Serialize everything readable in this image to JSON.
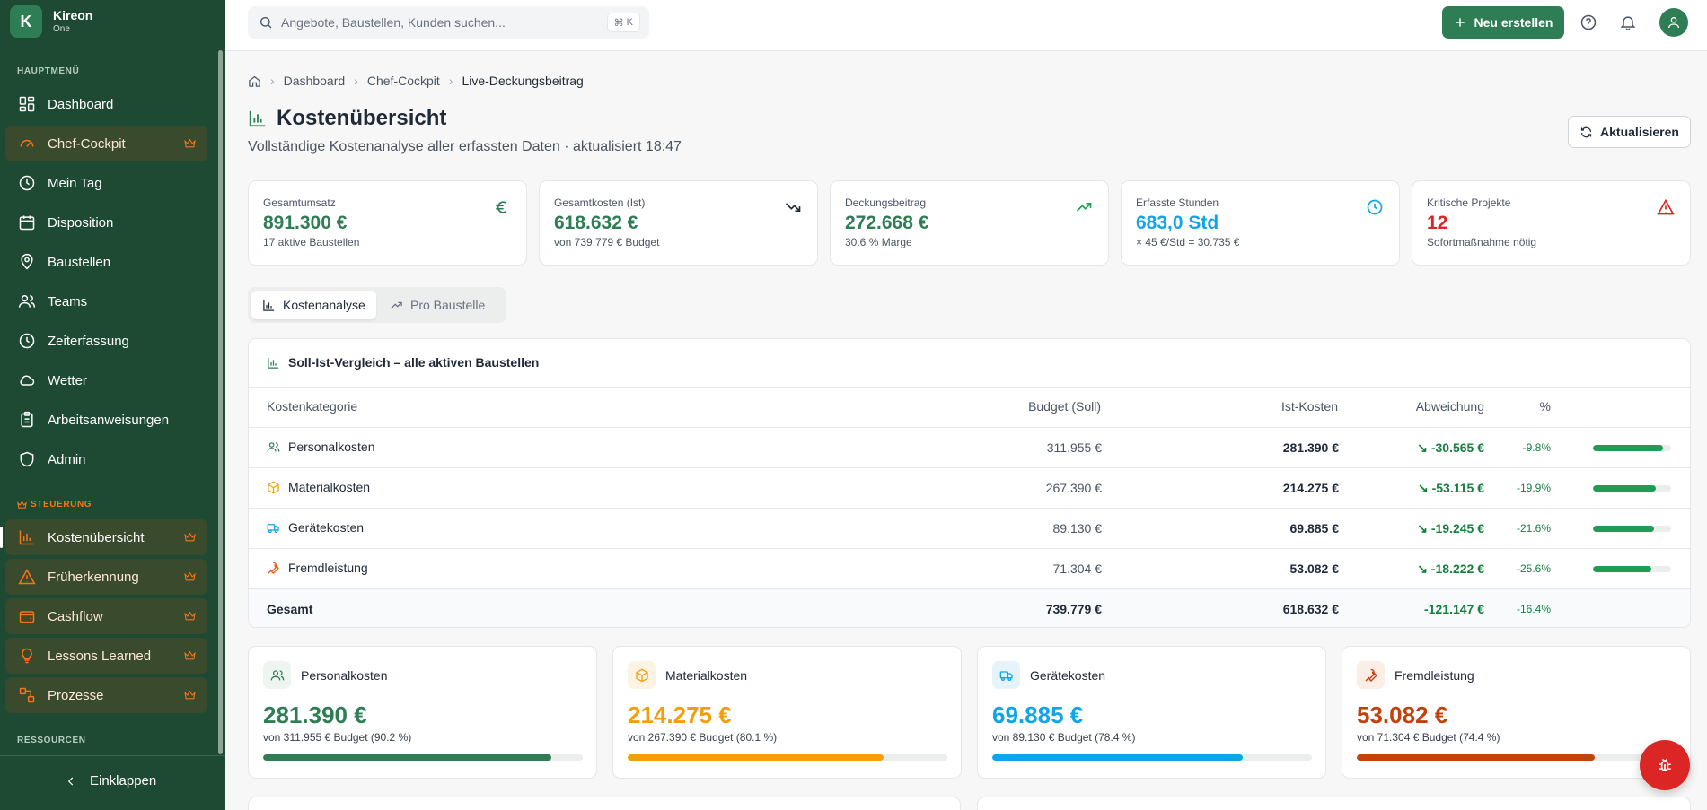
{
  "brand": {
    "name": "Kireon",
    "sub": "One",
    "logo_letter": "K"
  },
  "sidebar": {
    "section_main": "HAUPTMENÜ",
    "section_steering": "STEUERUNG",
    "section_resources": "RESSOURCEN",
    "items": [
      {
        "label": "Dashboard",
        "icon": "dashboard-icon"
      },
      {
        "label": "Chef-Cockpit",
        "icon": "gauge-icon",
        "pro": true
      },
      {
        "label": "Mein Tag",
        "icon": "clock-icon"
      },
      {
        "label": "Disposition",
        "icon": "calendar-icon"
      },
      {
        "label": "Baustellen",
        "icon": "map-pin-icon"
      },
      {
        "label": "Teams",
        "icon": "users-icon"
      },
      {
        "label": "Zeiterfassung",
        "icon": "clock-icon"
      },
      {
        "label": "Wetter",
        "icon": "cloud-icon"
      },
      {
        "label": "Arbeitsanweisungen",
        "icon": "clipboard-icon"
      },
      {
        "label": "Admin",
        "icon": "shield-icon"
      }
    ],
    "steering_items": [
      {
        "label": "Kostenübersicht",
        "icon": "bar-chart-icon",
        "active": true
      },
      {
        "label": "Früherkennung",
        "icon": "warning-icon"
      },
      {
        "label": "Cashflow",
        "icon": "wallet-icon"
      },
      {
        "label": "Lessons Learned",
        "icon": "lightbulb-icon"
      },
      {
        "label": "Prozesse",
        "icon": "workflow-icon"
      }
    ],
    "collapse_label": "Einklappen"
  },
  "topbar": {
    "search_placeholder": "Angebote, Baustellen, Kunden suchen...",
    "shortcut_key": "K",
    "new_button": "Neu erstellen"
  },
  "breadcrumb": [
    "Dashboard",
    "Chef-Cockpit",
    "Live-Deckungsbeitrag"
  ],
  "page": {
    "title": "Kostenübersicht",
    "subtitle": "Vollständige Kostenanalyse aller erfassten Daten · aktualisiert 18:47",
    "refresh_button": "Aktualisieren"
  },
  "kpis": [
    {
      "label": "Gesamtumsatz",
      "value": "891.300 €",
      "sub": "17 aktive Baustellen",
      "color": "#2f7d55",
      "icon": "euro-icon"
    },
    {
      "label": "Gesamtkosten (Ist)",
      "value": "618.632 €",
      "sub": "von 739.779 € Budget",
      "color": "#2f7d55",
      "icon": "trending-down-icon"
    },
    {
      "label": "Deckungsbeitrag",
      "value": "272.668 €",
      "sub": "30.6 % Marge",
      "color": "#2f7d55",
      "icon": "trending-up-icon"
    },
    {
      "label": "Erfasste Stunden",
      "value": "683,0 Std",
      "sub": "× 45 €/Std = 30.735 €",
      "color": "#0ea5e9",
      "icon": "clock-icon"
    },
    {
      "label": "Kritische Projekte",
      "value": "12",
      "sub": "Sofortmaßnahme nötig",
      "color": "#dc2626",
      "icon": "warning-icon"
    }
  ],
  "tabs": [
    {
      "label": "Kostenanalyse",
      "active": true
    },
    {
      "label": "Pro Baustelle",
      "active": false
    }
  ],
  "table": {
    "title": "Soll-Ist-Vergleich – alle aktiven Baustellen",
    "headers": [
      "Kostenkategorie",
      "Budget (Soll)",
      "Ist-Kosten",
      "Abweichung",
      "%"
    ],
    "rows": [
      {
        "category": "Personalkosten",
        "icon": "users-icon",
        "icon_color": "#2f7d55",
        "budget": "311.955 €",
        "actual": "281.390 €",
        "deviation": "-30.565 €",
        "percent": "-9.8%",
        "fill": 0.902
      },
      {
        "category": "Materialkosten",
        "icon": "package-icon",
        "icon_color": "#f59e0b",
        "budget": "267.390 €",
        "actual": "214.275 €",
        "deviation": "-53.115 €",
        "percent": "-19.9%",
        "fill": 0.801
      },
      {
        "category": "Gerätekosten",
        "icon": "truck-icon",
        "icon_color": "#0ea5e9",
        "budget": "89.130 €",
        "actual": "69.885 €",
        "deviation": "-19.245 €",
        "percent": "-21.6%",
        "fill": 0.784
      },
      {
        "category": "Fremdleistung",
        "icon": "wrench-icon",
        "icon_color": "#ea580c",
        "budget": "71.304 €",
        "actual": "53.082 €",
        "deviation": "-18.222 €",
        "percent": "-25.6%",
        "fill": 0.744
      }
    ],
    "total": {
      "label": "Gesamt",
      "budget": "739.779 €",
      "actual": "618.632 €",
      "deviation": "-121.147 €",
      "percent": "-16.4%"
    }
  },
  "category_cards": [
    {
      "label": "Personalkosten",
      "value": "281.390 €",
      "sub": "von 311.955 € Budget (90.2 %)",
      "color": "#2f7d55",
      "bg": "#eef4f0",
      "fill": 0.902,
      "icon": "users-icon"
    },
    {
      "label": "Materialkosten",
      "value": "214.275 €",
      "sub": "von 267.390 € Budget (80.1 %)",
      "color": "#f59e0b",
      "bg": "#fdf3e2",
      "fill": 0.801,
      "icon": "package-icon"
    },
    {
      "label": "Gerätekosten",
      "value": "69.885 €",
      "sub": "von 89.130 € Budget (78.4 %)",
      "color": "#0ea5e9",
      "bg": "#e6f3fb",
      "fill": 0.784,
      "icon": "truck-icon"
    },
    {
      "label": "Fremdleistung",
      "value": "53.082 €",
      "sub": "von 71.304 € Budget (74.4 %)",
      "color": "#c2410c",
      "bg": "#fbeee6",
      "fill": 0.744,
      "icon": "wrench-icon"
    }
  ]
}
